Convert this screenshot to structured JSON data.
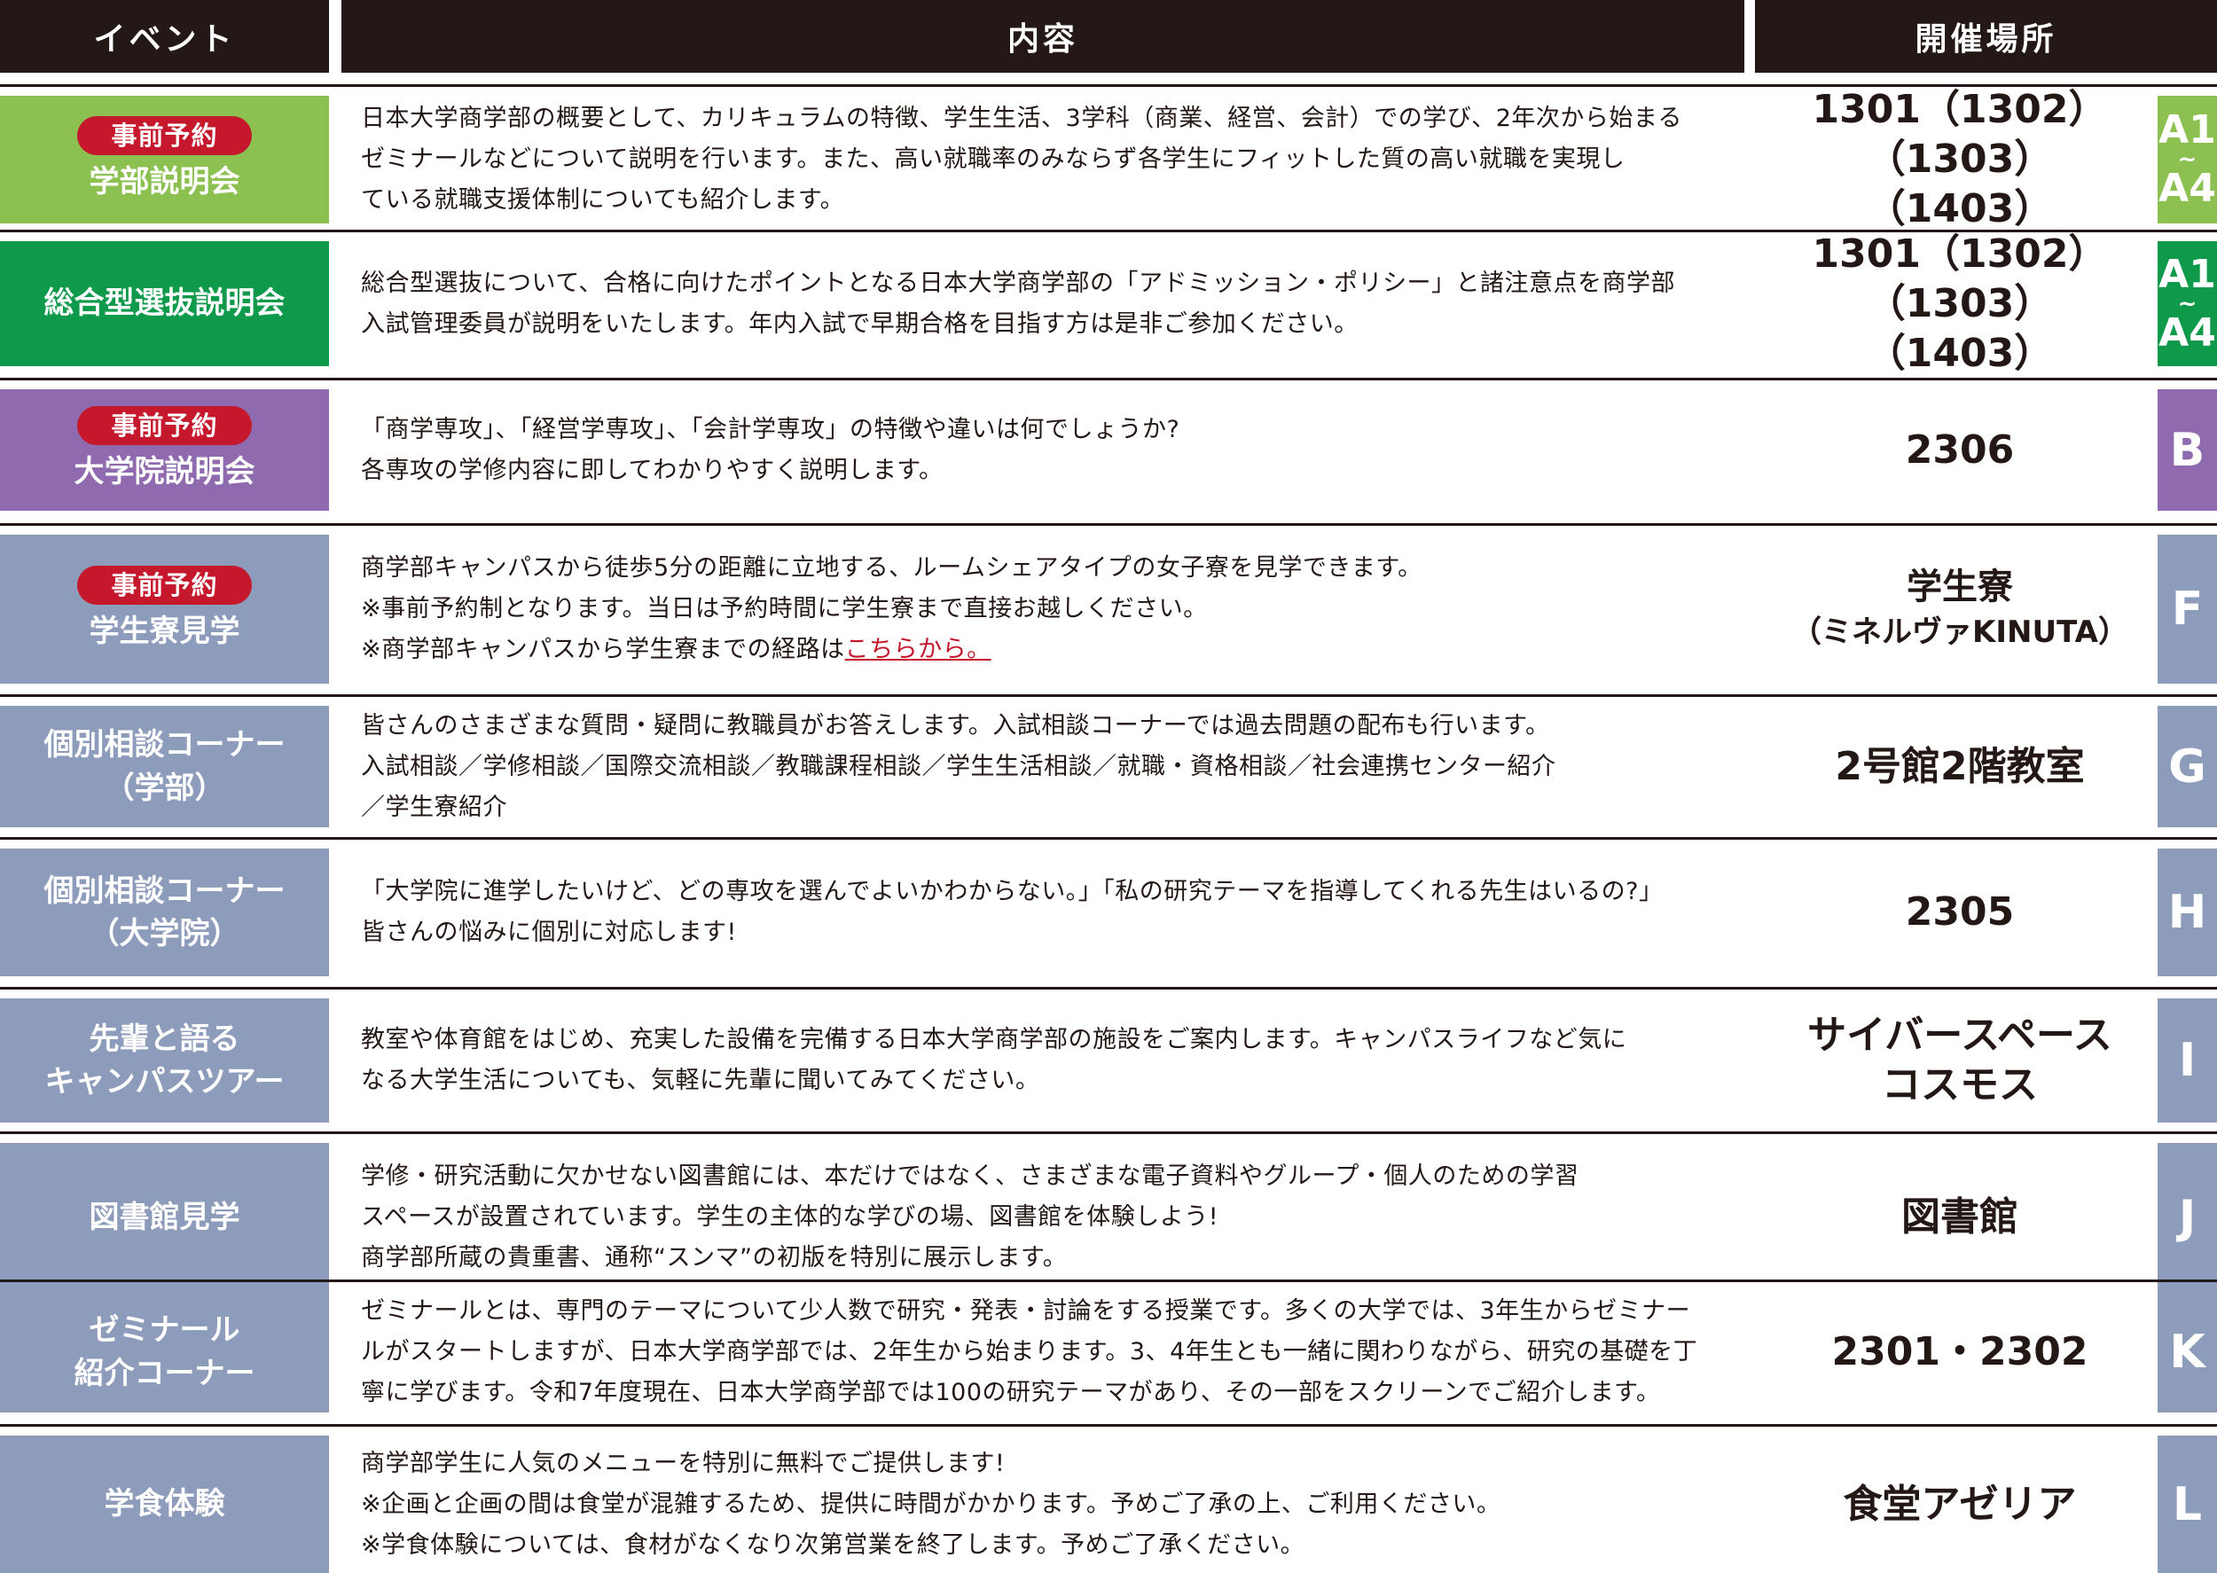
{
  "header": {
    "event": "イベント",
    "content": "内容",
    "place": "開催場所"
  },
  "colors": {
    "light_green": "#8cc151",
    "dark_green": "#0e9a4a",
    "purple": "#8f6aaf",
    "slate": "#8e9cbb",
    "badge_red": "#c5182c",
    "header_black": "#231815"
  },
  "badge_label": "事前予約",
  "rows": [
    {
      "title_lines": [
        "学部説明会"
      ],
      "badge": true,
      "desc_lines": [
        "日本大学商学部の概要として、カリキュラムの特徴、学生生活、3学科（商業、経営、会計）での学び、2年次から始まる",
        "ゼミナールなどについて説明を行います。また、高い就職率のみならず各学生にフィットした質の高い就職を実現し",
        "ている就職支援体制についても紹介します。"
      ],
      "place_lines": [
        "1301（1302）（1303）",
        "（1403）"
      ],
      "tag": [
        "A1",
        "~",
        "A4"
      ]
    },
    {
      "title_lines": [
        "総合型選抜説明会"
      ],
      "badge": false,
      "desc_lines": [
        "総合型選抜について、合格に向けたポイントとなる日本大学商学部の「アドミッション・ポリシー」と諸注意点を商学部",
        "入試管理委員が説明をいたします。年内入試で早期合格を目指す方は是非ご参加ください。"
      ],
      "place_lines": [
        "1301（1302）（1303）",
        "（1403）"
      ],
      "tag": [
        "A1",
        "~",
        "A4"
      ]
    },
    {
      "title_lines": [
        "大学院説明会"
      ],
      "badge": true,
      "desc_lines": [
        "「商学専攻」、「経営学専攻」、「会計学専攻」の特徴や違いは何でしょうか?",
        "各専攻の学修内容に即してわかりやすく説明します。"
      ],
      "place_lines": [
        "2306"
      ],
      "tag": [
        "B"
      ]
    },
    {
      "title_lines": [
        "学生寮見学"
      ],
      "badge": true,
      "desc_lines": [
        "商学部キャンパスから徒歩5分の距離に立地する、ルームシェアタイプの女子寮を見学できます。",
        "※事前予約制となります。当日は予約時間に学生寮まで直接お越しください。",
        "※商学部キャンパスから学生寮までの経路は"
      ],
      "desc_link": "こちらから。",
      "place_lines": [
        "学生寮",
        "（ミネルヴァKINUTA）"
      ],
      "tag": [
        "F"
      ]
    },
    {
      "title_lines": [
        "個別相談コーナー",
        "（学部）"
      ],
      "badge": false,
      "desc_lines": [
        "皆さんのさまざまな質問・疑問に教職員がお答えします。入試相談コーナーでは過去問題の配布も行います。",
        "入試相談／学修相談／国際交流相談／教職課程相談／学生生活相談／就職・資格相談／社会連携センター紹介",
        "／学生寮紹介"
      ],
      "place_lines": [
        "2号館2階教室"
      ],
      "tag": [
        "G"
      ]
    },
    {
      "title_lines": [
        "個別相談コーナー",
        "（大学院）"
      ],
      "badge": false,
      "desc_lines": [
        "「大学院に進学したいけど、どの専攻を選んでよいかわからない。」「私の研究テーマを指導してくれる先生はいるの?」",
        "皆さんの悩みに個別に対応します!"
      ],
      "place_lines": [
        "2305"
      ],
      "tag": [
        "H"
      ]
    },
    {
      "title_lines": [
        "先輩と語る",
        "キャンパスツアー"
      ],
      "badge": false,
      "desc_lines": [
        "教室や体育館をはじめ、充実した設備を完備する日本大学商学部の施設をご案内します。キャンパスライフなど気に",
        "なる大学生活についても、気軽に先輩に聞いてみてください。"
      ],
      "place_lines": [
        "サイバースペース",
        "コスモス"
      ],
      "tag": [
        "I"
      ]
    },
    {
      "title_lines": [
        "図書館見学"
      ],
      "badge": false,
      "desc_lines": [
        "学修・研究活動に欠かせない図書館には、本だけではなく、さまざまな電子資料やグループ・個人のための学習",
        "スペースが設置されています。学生の主体的な学びの場、図書館を体験しよう!",
        "商学部所蔵の貴重書、通称“スンマ”の初版を特別に展示します。"
      ],
      "place_lines": [
        "図書館"
      ],
      "tag": [
        "J"
      ]
    },
    {
      "title_lines": [
        "ゼミナール",
        "紹介コーナー"
      ],
      "badge": false,
      "desc_lines": [
        "ゼミナールとは、専門のテーマについて少人数で研究・発表・討論をする授業です。多くの大学では、3年生からゼミナー",
        "ルがスタートしますが、日本大学商学部では、2年生から始まります。3、4年生とも一緒に関わりながら、研究の基礎を丁",
        "寧に学びます。令和7年度現在、日本大学商学部では100の研究テーマがあり、その一部をスクリーンでご紹介します。"
      ],
      "place_lines": [
        "2301・2302"
      ],
      "tag": [
        "K"
      ]
    },
    {
      "title_lines": [
        "学食体験"
      ],
      "badge": false,
      "desc_lines": [
        "商学部学生に人気のメニューを特別に無料でご提供します!",
        "※企画と企画の間は食堂が混雑するため、提供に時間がかかります。予めご了承の上、ご利用ください。",
        "※学食体験については、食材がなくなり次第営業を終了します。予めご了承ください。"
      ],
      "place_lines": [
        "食堂アゼリア"
      ],
      "tag": [
        "L"
      ]
    }
  ]
}
